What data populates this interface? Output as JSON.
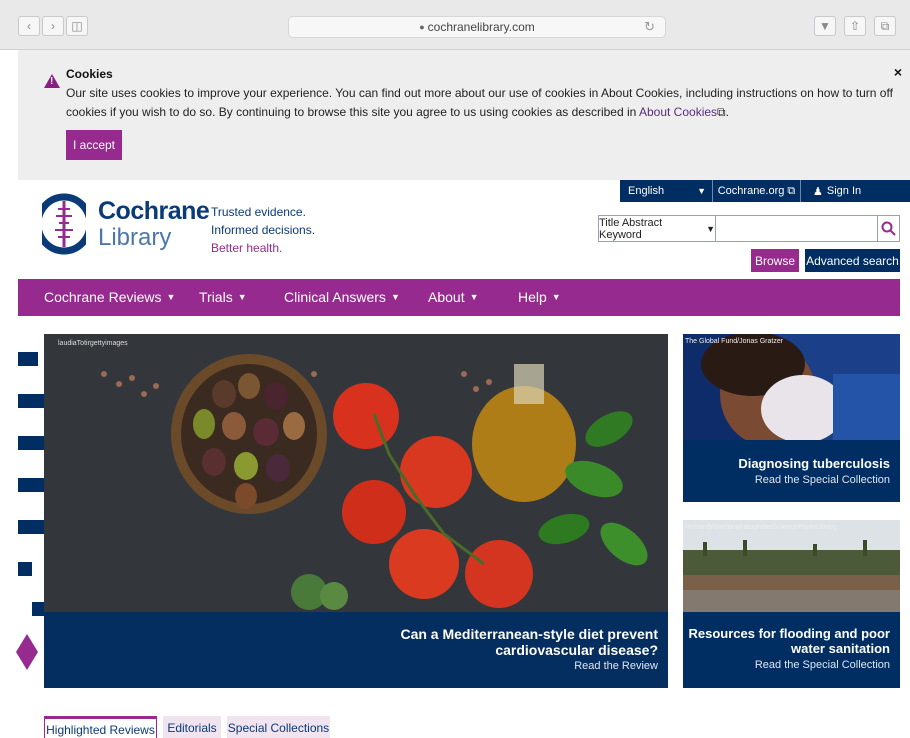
{
  "browser": {
    "url": "cochranelibrary.com"
  },
  "cookie": {
    "title": "Cookies",
    "text_before_link": "Our site uses cookies to improve your experience. You can find out more about our use of cookies in About Cookies, including instructions on how to turn off cookies if you wish to do so. By continuing to browse this site you agree to us using cookies as described in ",
    "link": "About Cookies",
    "text_after_link": ".",
    "close": "×",
    "accept": "I accept"
  },
  "header": {
    "logo_name": "Cochrane",
    "logo_sub": "Library",
    "tagline_1": "Trusted evidence.",
    "tagline_2": "Informed decisions.",
    "tagline_3": "Better health."
  },
  "utility": {
    "language": "English",
    "cochrane_org": "Cochrane.org",
    "sign_in": "Sign In"
  },
  "search": {
    "field": "Title Abstract Keyword",
    "browse": "Browse",
    "advanced": "Advanced search"
  },
  "nav": {
    "items": [
      {
        "label": "Cochrane Reviews"
      },
      {
        "label": "Trials"
      },
      {
        "label": "Clinical Answers"
      },
      {
        "label": "About"
      },
      {
        "label": "Help"
      }
    ]
  },
  "hero": {
    "credit": "laudiaTotirgettyimages",
    "title": "Can a Mediterranean-style diet prevent cardiovascular disease?",
    "link": "Read the Review"
  },
  "cards": [
    {
      "credit": "The Global Fund/Jonas Gratzer",
      "title": "Diagnosing tuberculosis",
      "link": "Read the Special Collection"
    },
    {
      "credit": "RichardWarehamFotografie/SciencePhotoLibrary",
      "title": "Resources for flooding and poor water sanitation",
      "link": "Read the Special Collection"
    }
  ],
  "tabs": [
    {
      "label": "Highlighted Reviews"
    },
    {
      "label": "Editorials"
    },
    {
      "label": "Special Collections"
    }
  ],
  "colors": {
    "brand_purple": "#962a8e",
    "brand_navy": "#002e63"
  }
}
